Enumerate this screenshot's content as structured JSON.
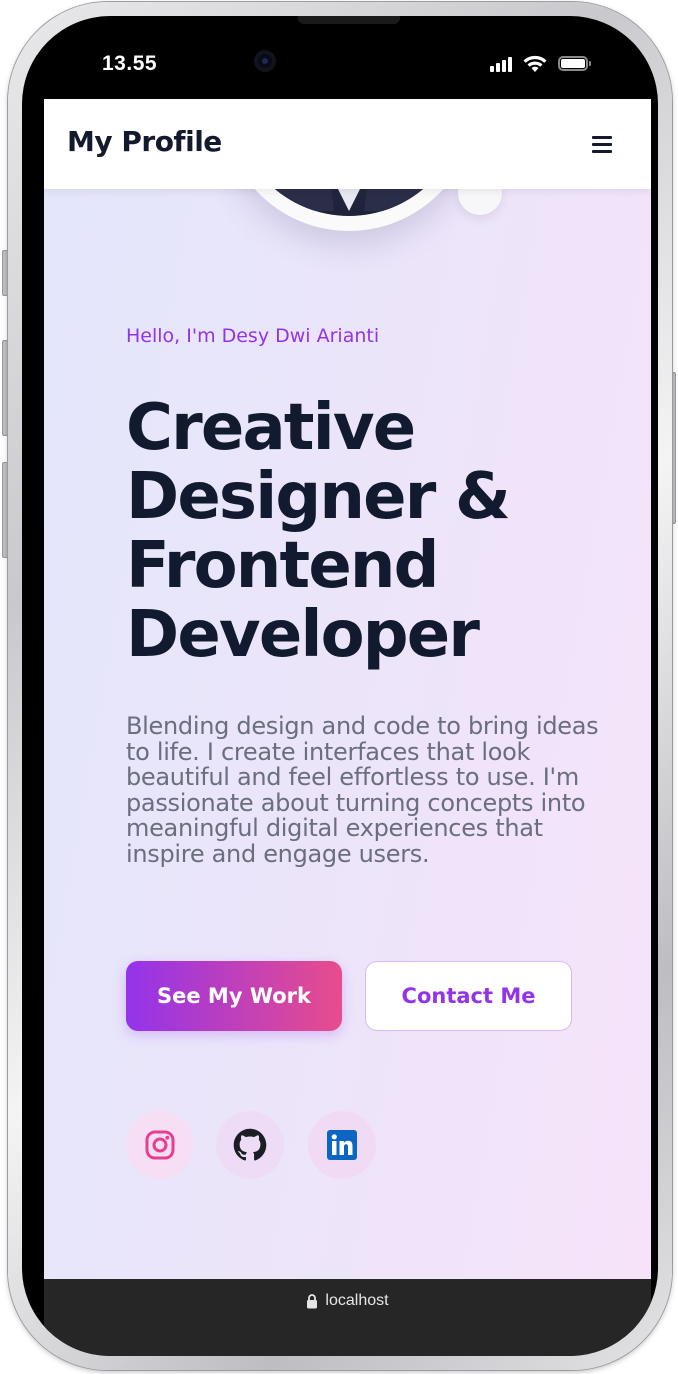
{
  "status_bar": {
    "time": "13.55"
  },
  "navbar": {
    "title": "My Profile",
    "menu_icon": "hamburger-menu-icon"
  },
  "hero": {
    "greeting": "Hello, I'm Desy Dwi Arianti",
    "headline_lines": [
      "Creative",
      "Designer &",
      "Frontend",
      "Developer"
    ],
    "description": "Blending design and code to bring ideas to life. I create interfaces that look beautiful and feel effortless to use. I'm passionate about turning concepts into meaningful digital experiences that inspire and engage users.",
    "primary_button": "See My Work",
    "secondary_button": "Contact Me"
  },
  "social_links": [
    {
      "name": "instagram",
      "icon": "instagram-icon",
      "color": "#e4408f"
    },
    {
      "name": "github",
      "icon": "github-icon",
      "color": "#1b1f24"
    },
    {
      "name": "linkedin",
      "icon": "linkedin-icon",
      "color": "#0a66c2"
    }
  ],
  "browser_bar": {
    "url": "localhost"
  },
  "colors": {
    "accent_purple": "#9333ea",
    "accent_pink": "#e84c8c",
    "heading": "#121a2f",
    "body_text": "#6a6e7e"
  }
}
